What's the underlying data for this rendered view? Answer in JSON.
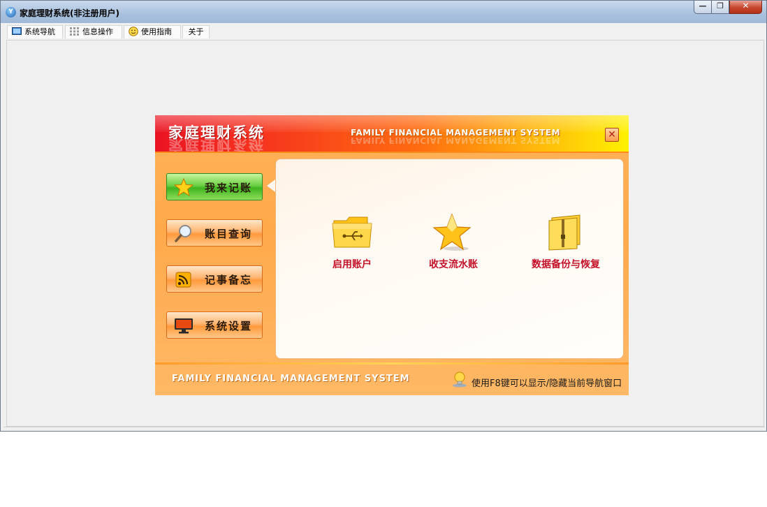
{
  "window": {
    "title": "家庭理财系统(非注册用户)",
    "controls": {
      "minimize": "—",
      "maximize": "❐",
      "close": "✕"
    }
  },
  "menu": [
    {
      "label": "系统导航",
      "icon": "monitor-icon"
    },
    {
      "label": "信息操作",
      "icon": "grid-icon"
    },
    {
      "label": "使用指南",
      "icon": "smile-icon"
    },
    {
      "label": "关于",
      "icon": ""
    }
  ],
  "panel": {
    "title": "家庭理财系统",
    "subtitle_en": "FAMILY FINANCIAL MANAGEMENT SYSTEM",
    "close_symbol": "✕",
    "nav": [
      {
        "label": "我来记账",
        "icon": "star-icon",
        "active": true
      },
      {
        "label": "账目查询",
        "icon": "magnifier-icon",
        "active": false
      },
      {
        "label": "记事备忘",
        "icon": "rss-icon",
        "active": false
      },
      {
        "label": "系统设置",
        "icon": "monitor-icon",
        "active": false
      }
    ],
    "functions": [
      {
        "label": "启用账户",
        "icon": "usb-folder-icon"
      },
      {
        "label": "收支流水账",
        "icon": "star-icon"
      },
      {
        "label": "数据备份与恢复",
        "icon": "zip-folder-icon"
      }
    ],
    "footer_en": "FAMILY FINANCIAL MANAGEMENT SYSTEM",
    "footer_hint": "使用F8键可以显示/隐藏当前导航窗口"
  },
  "colors": {
    "banner_red": "#ea1322",
    "banner_yellow": "#fff100",
    "accent_orange": "#ffa94a",
    "active_green": "#3fb51f",
    "label_red": "#c4122a"
  }
}
